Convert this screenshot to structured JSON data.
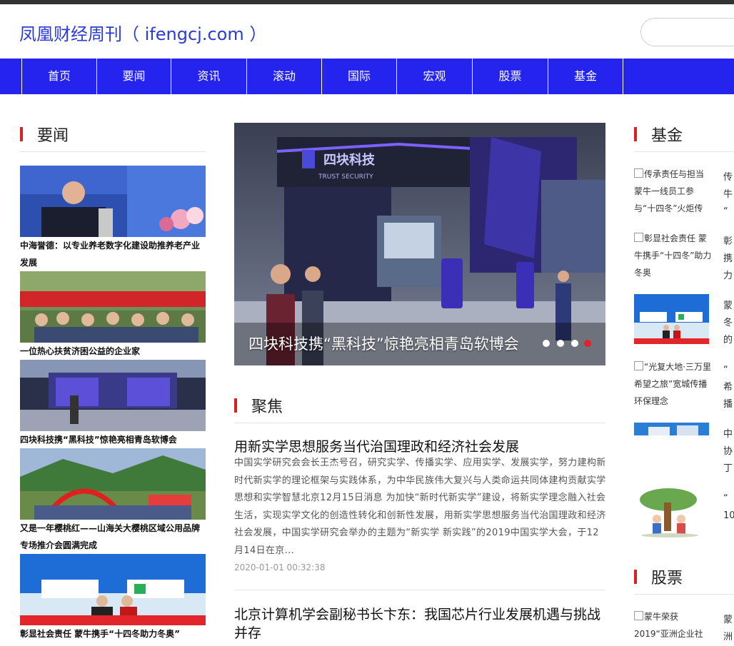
{
  "site_title": "凤凰财经周刊（ ifengcj.com ）",
  "nav": [
    "首页",
    "要闻",
    "资讯",
    "滚动",
    "国际",
    "宏观",
    "股票",
    "基金"
  ],
  "sections": {
    "yaowen": "要闻",
    "jujiao": "聚焦",
    "jijin": "基金",
    "gupiao": "股票"
  },
  "left_news": [
    {
      "title": "中海誉德：以专业养老数字化建设助推养老产业发展"
    },
    {
      "title": "一位热心扶贫济困公益的企业家"
    },
    {
      "title": "四块科技携“黑科技”惊艳亮相青岛软博会"
    },
    {
      "title": "又是一年樱桃红——山海关大樱桃区域公用品牌专场推介会圆满完成"
    },
    {
      "title": "彰显社会责任 蒙牛携手“十四冬助力冬奥”"
    }
  ],
  "slider": {
    "caption": "四块科技携“黑科技”惊艳亮相青岛软博会",
    "booth_brand": "四块科技",
    "booth_sub": "TRUST SECURITY",
    "dots": 4,
    "active_dot": 3
  },
  "articles": [
    {
      "title": "用新实学思想服务当代治国理政和经济社会发展",
      "summary": "中国实学研究会会长王杰号召，研究实学、传播实学、应用实学、发展实学，努力建构新时代新实学的理论框架与实践体系，为中华民族伟大复兴与人类命运共同体建构贡献实学思想和实学智慧北京12月15日消息 为加快“新时代新实学”建设，将新实学理念融入社会生活，实现实学文化的创造性转化和创新性发展，用新实学思想服务当代治国理政和经济社会发展，中国实学研究会举办的主题为“新实学 新实践”的2019中国实学大会，于12月14日在京...",
      "date": "2020-01-01 00:32:38"
    },
    {
      "title": "北京计算机学会副秘书长卞东：我国芯片行业发展机遇与挑战并存"
    }
  ],
  "fund_items": [
    {
      "alt": "传承责任与担当 蒙牛一线员工参与“十四冬”火炬传",
      "side": [
        "传",
        "牛",
        "“"
      ]
    },
    {
      "alt": "彰显社会责任 蒙牛携手“十四冬”助力冬奥",
      "side": [
        "彰",
        "携",
        "力"
      ]
    },
    {
      "side": [
        "蒙",
        "冬",
        "的"
      ]
    },
    {
      "alt": "“光复大地·三万里希望之旅”宽城传播环保理念",
      "side": [
        "“",
        "希",
        "播"
      ]
    },
    {
      "side": [
        "中",
        "协",
        "丁"
      ]
    },
    {
      "side": [
        "“",
        "10"
      ]
    }
  ],
  "stock_items": [
    {
      "alt": "蒙牛荣获 2019“亚洲企业社",
      "side": [
        "蒙",
        "洲"
      ]
    }
  ],
  "colors": {
    "brand_blue": "#2424ee",
    "title_blue": "#2b3bd6",
    "section_red": "#e02020",
    "dot_active": "#e8202a"
  }
}
